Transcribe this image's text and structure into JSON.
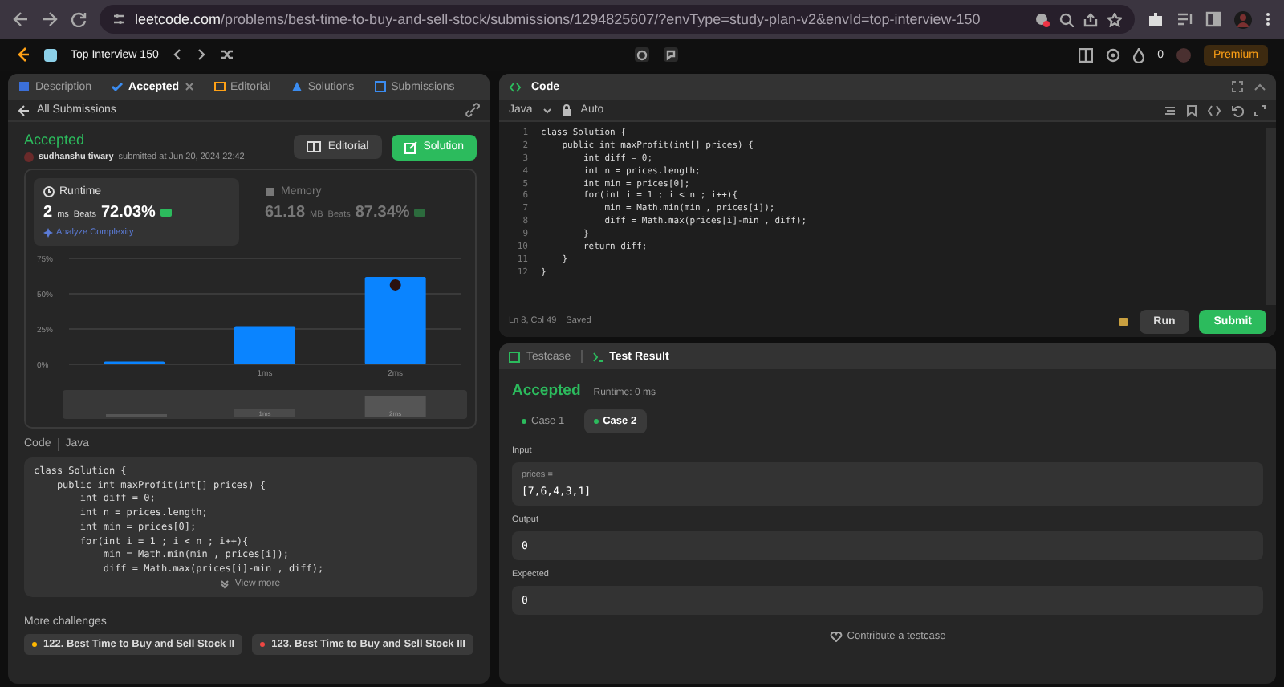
{
  "browser": {
    "host": "leetcode.com",
    "path": "/problems/best-time-to-buy-and-sell-stock/submissions/1294825607/?envType=study-plan-v2&envId=top-interview-150"
  },
  "nav": {
    "study_plan": "Top Interview 150",
    "streak": "0",
    "premium": "Premium"
  },
  "left_tabs": [
    {
      "label": "Description",
      "selected": false,
      "closable": false
    },
    {
      "label": "Accepted",
      "selected": true,
      "closable": true
    },
    {
      "label": "Editorial",
      "selected": false,
      "closable": false
    },
    {
      "label": "Solutions",
      "selected": false,
      "closable": false
    },
    {
      "label": "Submissions",
      "selected": false,
      "closable": false
    }
  ],
  "back_link": "All Submissions",
  "submission": {
    "status": "Accepted",
    "user": "sudhanshu tiwary",
    "submitted": "submitted at Jun 20, 2024 22:42",
    "editorial": "Editorial",
    "solution": "Solution"
  },
  "stats": [
    {
      "label": "Runtime",
      "value": "2",
      "unit": "ms",
      "beats_label": "Beats",
      "beats": "72.03%",
      "selected": true
    },
    {
      "label": "Memory",
      "value": "61.18",
      "unit": "MB",
      "beats_label": "Beats",
      "beats": "87.34%",
      "selected": false
    }
  ],
  "analyze": "Analyze Complexity",
  "chart_data": {
    "type": "bar",
    "categories": [
      null,
      "1ms",
      "2ms"
    ],
    "values": [
      2,
      27,
      62
    ],
    "ylim": [
      0,
      75
    ],
    "yticks": [
      {
        "value": 0,
        "label": "0%"
      },
      {
        "value": 25,
        "label": "25%"
      },
      {
        "value": 50,
        "label": "50%"
      },
      {
        "value": 75,
        "label": "75%"
      }
    ]
  },
  "brush_labels": [
    "1ms",
    "2ms"
  ],
  "code_section": {
    "label": "Code",
    "language": "Java",
    "view_more": "View more",
    "lines": [
      "class Solution {",
      "    public int maxProfit(int[] prices) {",
      "        int diff = 0;",
      "        int n = prices.length;",
      "        int min = prices[0];",
      "        for(int i = 1 ; i < n ; i++){",
      "            min = Math.min(min , prices[i]);",
      "            diff = Math.max(prices[i]-min , diff);"
    ]
  },
  "more_challenges": {
    "title": "More challenges",
    "items": [
      {
        "label": "122. Best Time to Buy and Sell Stock II",
        "color": "#ffb800"
      },
      {
        "label": "123. Best Time to Buy and Sell Stock III",
        "color": "#ef4743"
      }
    ]
  },
  "editor": {
    "title": "Code",
    "language": "Java",
    "mode": "Auto",
    "status": "Ln 8, Col 49",
    "saved": "Saved",
    "run": "Run",
    "submit": "Submit",
    "lines": [
      {
        "no": "1",
        "code": "class Solution {"
      },
      {
        "no": "2",
        "code": "    public int maxProfit(int[] prices) {"
      },
      {
        "no": "3",
        "code": "        int diff = 0;"
      },
      {
        "no": "4",
        "code": "        int n = prices.length;"
      },
      {
        "no": "5",
        "code": "        int min = prices[0];"
      },
      {
        "no": "6",
        "code": "        for(int i = 1 ; i < n ; i++){"
      },
      {
        "no": "7",
        "code": "            min = Math.min(min , prices[i]);"
      },
      {
        "no": "8",
        "code": "            diff = Math.max(prices[i]-min , diff);"
      },
      {
        "no": "9",
        "code": "        }"
      },
      {
        "no": "10",
        "code": "        return diff;"
      },
      {
        "no": "11",
        "code": "    }"
      },
      {
        "no": "12",
        "code": "}"
      }
    ]
  },
  "result": {
    "tabs": [
      {
        "label": "Testcase",
        "selected": false
      },
      {
        "label": "Test Result",
        "selected": true
      }
    ],
    "status": "Accepted",
    "runtime": "Runtime: 0 ms",
    "cases": [
      {
        "label": "Case 1",
        "selected": false
      },
      {
        "label": "Case 2",
        "selected": true
      }
    ],
    "input_label": "Input",
    "param": "prices =",
    "input": "[7,6,4,3,1]",
    "output_label": "Output",
    "output": "0",
    "expected_label": "Expected",
    "expected": "0",
    "contribute": "Contribute a testcase"
  }
}
